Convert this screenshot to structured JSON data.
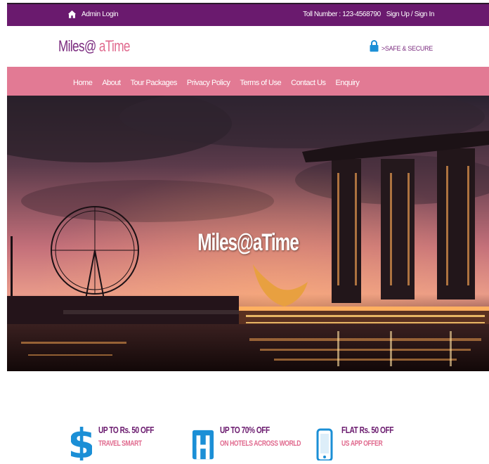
{
  "topbar": {
    "admin_login": "Admin Login",
    "toll_number": "Toll Number : 123-4568790",
    "signup_signin": "Sign Up / Sign In",
    "home_icon": "home-icon"
  },
  "header": {
    "logo_part1": "Miles@",
    "logo_part2": " aTime",
    "secure_label": ">SAFE & SECURE",
    "lock_icon": "lock-icon"
  },
  "nav": {
    "items": [
      {
        "label": "Home"
      },
      {
        "label": "About"
      },
      {
        "label": "Tour Packages"
      },
      {
        "label": "Privacy Policy"
      },
      {
        "label": "Terms of Use"
      },
      {
        "label": "Contact Us"
      },
      {
        "label": "Enquiry"
      }
    ]
  },
  "hero": {
    "title": "Miles@aTime"
  },
  "offers": [
    {
      "icon": "dollar-icon",
      "title": "UP TO Rs. 50 OFF",
      "subtitle": "TRAVEL SMART"
    },
    {
      "icon": "hotel-icon",
      "title": "UP TO 70% OFF",
      "subtitle": "ON HOTELS ACROSS WORLD"
    },
    {
      "icon": "mobile-icon",
      "title": "FLAT Rs. 50 OFF",
      "subtitle": "US APP OFFER"
    }
  ],
  "colors": {
    "topbar": "#6a1a6e",
    "nav": "#e27a94",
    "accent_purple": "#6a1a6e",
    "accent_pink": "#e06a8e",
    "icon_blue": "#1b8fd6"
  }
}
